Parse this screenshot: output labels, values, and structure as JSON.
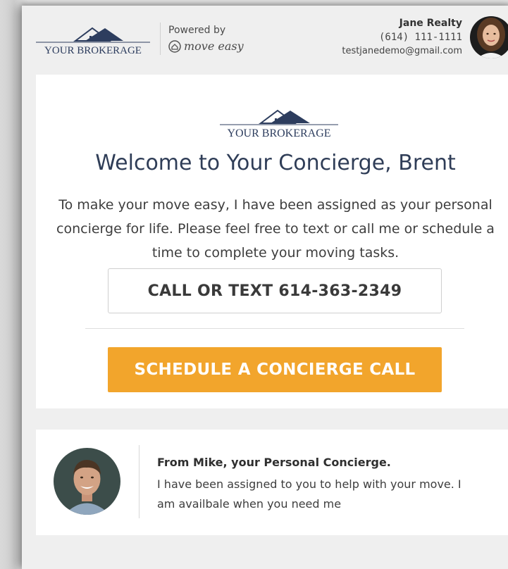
{
  "header": {
    "brokerage_logo_text": "YOUR BROKERAGE",
    "powered_by": "Powered by",
    "move_easy_brand": "move easy",
    "agent_name": "Jane Realty",
    "agent_phone": "(614) 111-1111",
    "agent_email": "testjanedemo@gmail.com"
  },
  "main": {
    "logo_text": "YOUR BROKERAGE",
    "welcome": "Welcome to Your Concierge, Brent",
    "intro": "To make your move easy, I have been assigned as your personal concierge for life. Please feel free to text or call me or schedule a time to complete your moving tasks.",
    "call_button": "CALL OR TEXT 614-363-2349",
    "schedule_button": "SCHEDULE A CONCIERGE CALL"
  },
  "concierge": {
    "title": "From Mike, your Personal Concierge.",
    "message": "I have been assigned to you  to help with your move. I am availbale when you need me"
  },
  "colors": {
    "accent_orange": "#f2a52c",
    "heading_navy": "#2f3d57",
    "logo_navy": "#2d3d5e"
  }
}
